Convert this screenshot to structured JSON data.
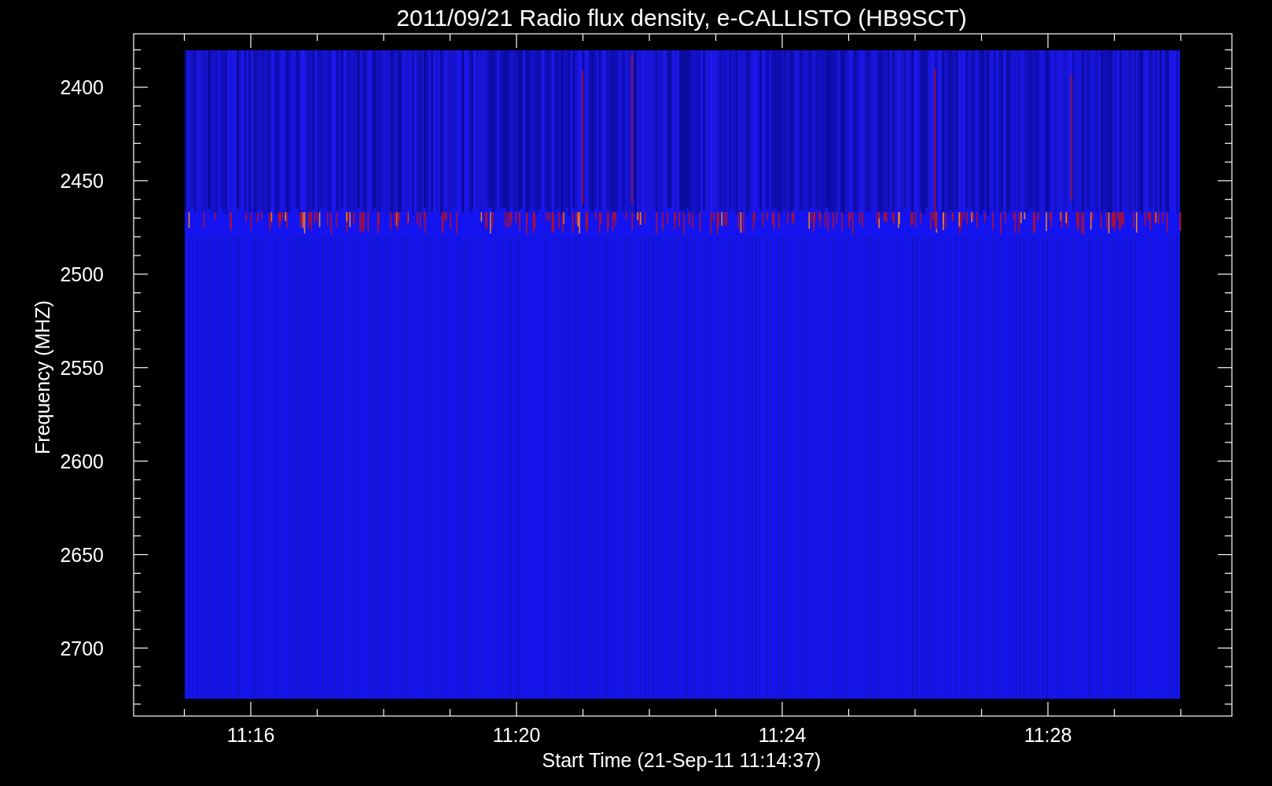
{
  "title": "2011/09/21  Radio flux density, e-CALLISTO (HB9SCT)",
  "y_axis": {
    "label": "Frequency (MHZ)",
    "ticks": [
      "2400",
      "2450",
      "2500",
      "2550",
      "2600",
      "2650",
      "2700"
    ]
  },
  "x_axis": {
    "label": "Start Time (21-Sep-11 11:14:37)",
    "ticks": [
      "11:16",
      "11:20",
      "11:24",
      "11:28"
    ]
  }
}
